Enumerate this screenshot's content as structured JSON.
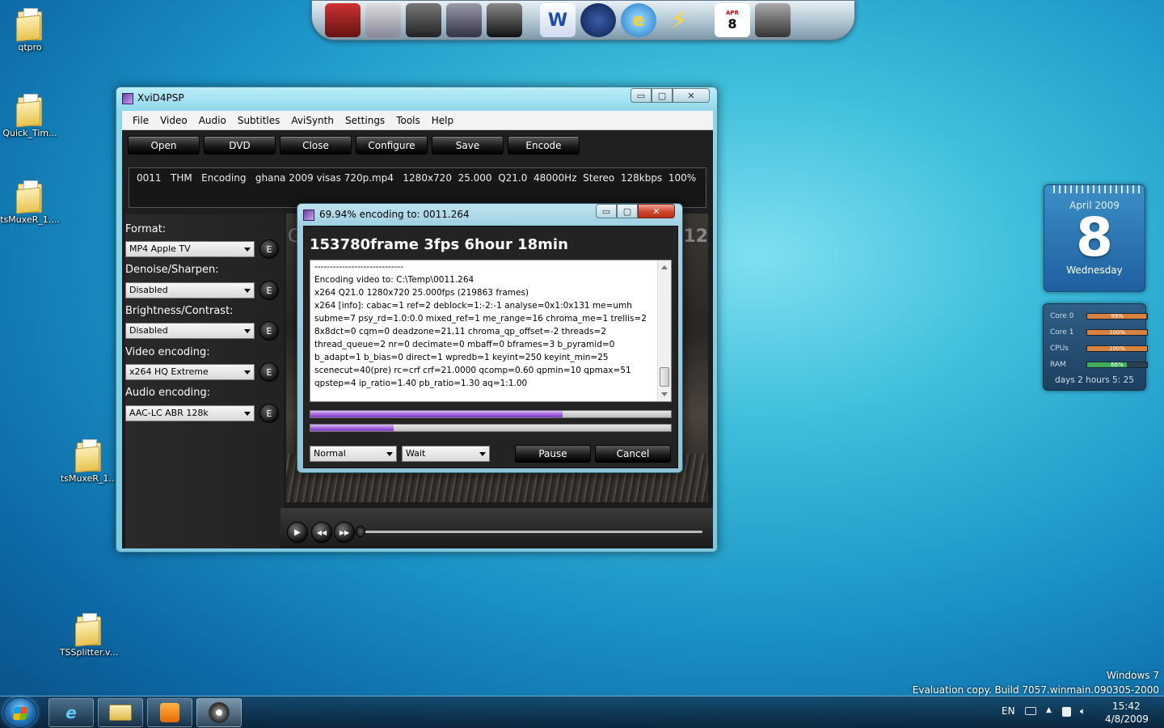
{
  "desktop": {
    "icons": [
      "qtpro",
      "Quick_Tim...",
      "tsMuxeR_1....",
      "tsMuxeR_1...",
      "TSSplitter.v..."
    ]
  },
  "dock": {
    "calendar_month": "APR",
    "calendar_day": "8",
    "word_icon": "W"
  },
  "window": {
    "title": "XviD4PSP",
    "caption": {
      "minimize": "▭",
      "maximize": "▢",
      "close": "✕"
    },
    "menu": [
      "File",
      "Video",
      "Audio",
      "Subtitles",
      "AviSynth",
      "Settings",
      "Tools",
      "Help"
    ],
    "toolbar": [
      "Open",
      "DVD",
      "Close",
      "Configure",
      "Save",
      "Encode"
    ],
    "info": "0011   THM   Encoding   ghana 2009 visas 720p.mp4   1280x720  25.000  Q21.0  48000Hz  Stereo  128kbps  100%",
    "panel": {
      "format_label": "Format:",
      "format_value": "MP4 Apple TV",
      "denoise_label": "Denoise/Sharpen:",
      "denoise_value": "Disabled",
      "brightness_label": "Brightness/Contrast:",
      "brightness_value": "Disabled",
      "video_label": "Video encoding:",
      "video_value": "x264 HQ Extreme",
      "audio_label": "Audio encoding:",
      "audio_value": "AAC-LC ABR 128k",
      "e_label": "E"
    },
    "video_overlay": {
      "left": "G",
      "right": "12"
    },
    "player": {
      "play": "▶",
      "prev": "◀◀",
      "next": "▶▶"
    }
  },
  "dialog": {
    "title": "69.94% encoding to: 0011.264",
    "header": "153780frame 3fps 6hour 18min",
    "log": [
      "-----------------------------",
      "Encoding video to: C:\\Temp\\0011.264",
      "x264 Q21.0 1280x720 25.000fps (219863 frames)",
      "x264 [info]: cabac=1 ref=2 deblock=1:-2:-1 analyse=0x1:0x131 me=umh",
      "subme=7 psy_rd=1.0:0.0 mixed_ref=1 me_range=16 chroma_me=1 trellis=2",
      "8x8dct=0 cqm=0 deadzone=21,11 chroma_qp_offset=-2 threads=2",
      "thread_queue=2 nr=0 decimate=0 mbaff=0 bframes=3 b_pyramid=0",
      "b_adapt=1 b_bias=0 direct=1 wpredb=1 keyint=250 keyint_min=25",
      "scenecut=40(pre) rc=crf crf=21.0000 qcomp=0.60 qpmin=10 qpmax=51",
      "qpstep=4 ip_ratio=1.40 pb_ratio=1.30 aq=1:1.00"
    ],
    "progress_main": 0.6994,
    "progress_secondary": 0.23,
    "priority": "Normal",
    "after": "Wait",
    "pause": "Pause",
    "cancel": "Cancel"
  },
  "gadgets": {
    "calendar": {
      "month": "April 2009",
      "day": "8",
      "weekday": "Wednesday"
    },
    "meter": [
      {
        "label": "Core 0",
        "value": "99%",
        "level": 0.99,
        "color": "#d9823d"
      },
      {
        "label": "Core 1",
        "value": "100%",
        "level": 1.0,
        "color": "#d9823d"
      },
      {
        "label": "CPUs",
        "value": "100%",
        "level": 1.0,
        "color": "#d9823d"
      },
      {
        "label": "RAM",
        "value": "66%",
        "level": 0.66,
        "color": "#3fae5a"
      }
    ],
    "uptime": "days 2 hours 5: 25"
  },
  "watermark": {
    "line1": "Windows 7",
    "line2": "Evaluation copy. Build 7057.winmain.090305-2000"
  },
  "taskbar": {
    "lang": "EN",
    "time": "15:42",
    "date": "4/8/2009"
  }
}
